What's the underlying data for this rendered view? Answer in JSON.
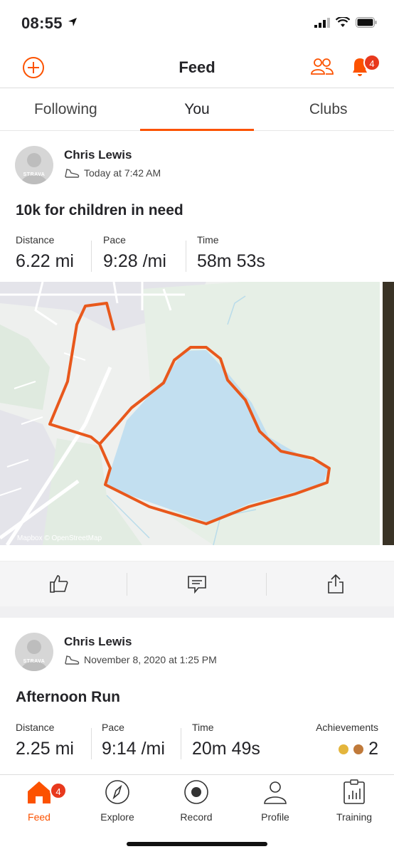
{
  "status_bar": {
    "time": "08:55"
  },
  "nav": {
    "title": "Feed",
    "notification_count": "4"
  },
  "tabs": [
    {
      "label": "Following"
    },
    {
      "label": "You"
    },
    {
      "label": "Clubs"
    }
  ],
  "activities": [
    {
      "athlete": "Chris Lewis",
      "avatar_text": "STRAVA",
      "timestamp": "Today at 7:42 AM",
      "title": "10k for children in need",
      "stats": [
        {
          "label": "Distance",
          "value": "6.22 mi"
        },
        {
          "label": "Pace",
          "value": "9:28 /mi"
        },
        {
          "label": "Time",
          "value": "58m 53s"
        }
      ],
      "map_attribution": "© Mapbox © OpenStreetMap"
    },
    {
      "athlete": "Chris Lewis",
      "avatar_text": "STRAVA",
      "timestamp": "November 8, 2020 at 1:25 PM",
      "title": "Afternoon Run",
      "stats": [
        {
          "label": "Distance",
          "value": "2.25 mi"
        },
        {
          "label": "Pace",
          "value": "9:14 /mi"
        },
        {
          "label": "Time",
          "value": "20m 49s"
        }
      ],
      "achievements_label": "Achievements",
      "achievements_count": "2"
    }
  ],
  "tabbar": {
    "items": [
      {
        "label": "Feed",
        "icon": "home-icon"
      },
      {
        "label": "Explore",
        "icon": "compass-icon"
      },
      {
        "label": "Record",
        "icon": "record-icon"
      },
      {
        "label": "Profile",
        "icon": "person-icon"
      },
      {
        "label": "Training",
        "icon": "training-icon"
      }
    ],
    "feed_badge": "4"
  },
  "colors": {
    "accent": "#fc5200",
    "badge": "#e8391d",
    "route": "#e8581c",
    "water": "#c2dff0",
    "park": "#e3eee3"
  }
}
